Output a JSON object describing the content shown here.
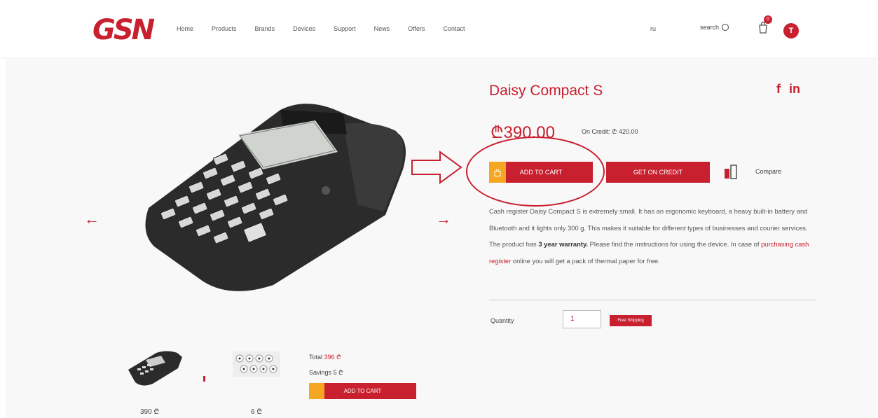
{
  "header": {
    "logo": "GSN",
    "nav": [
      "Home",
      "Products",
      "Brands",
      "Devices",
      "Support",
      "News",
      "Offers",
      "Contact"
    ],
    "language": "ru",
    "search_label": "search",
    "cart_count": "0",
    "avatar_initial": "T"
  },
  "product": {
    "title": "Daisy Compact S",
    "price": "₾390.00",
    "credit_price": "On Credit: ₾ 420.00",
    "add_to_cart_label": "ADD TO CART",
    "get_on_credit_label": "GET ON CREDIT",
    "compare_label": "Compare",
    "description_p1": "Cash register Daisy Compact S is extremely small. It has an ergonomic keyboard, a heavy built-in battery and Bluetooth and it lights only 300 g. This makes it suitable for different types of businesses and courier services. The product has ",
    "description_bold": "3 year warranty.",
    "description_p2": " Please find the instructions for using the device. In case of ",
    "description_link": "purchasing cash register",
    "description_p3": " online you will get a pack of thermal paper for free.",
    "quantity_label": "Quantity",
    "quantity_value": "1",
    "free_shipping_label": "Free Shipping"
  },
  "social": {
    "facebook": "f",
    "linkedin": "in"
  },
  "bundle": {
    "item1_price": "390 ₾",
    "item2_price": "6 ₾",
    "total_label": "Total ",
    "total_value": "396 ₾",
    "savings_label": "Savings 5 ₾",
    "add_to_cart_label": "ADD TO CART"
  },
  "colors": {
    "accent": "#c8202f",
    "cart_icon_bg": "#f5a623"
  }
}
